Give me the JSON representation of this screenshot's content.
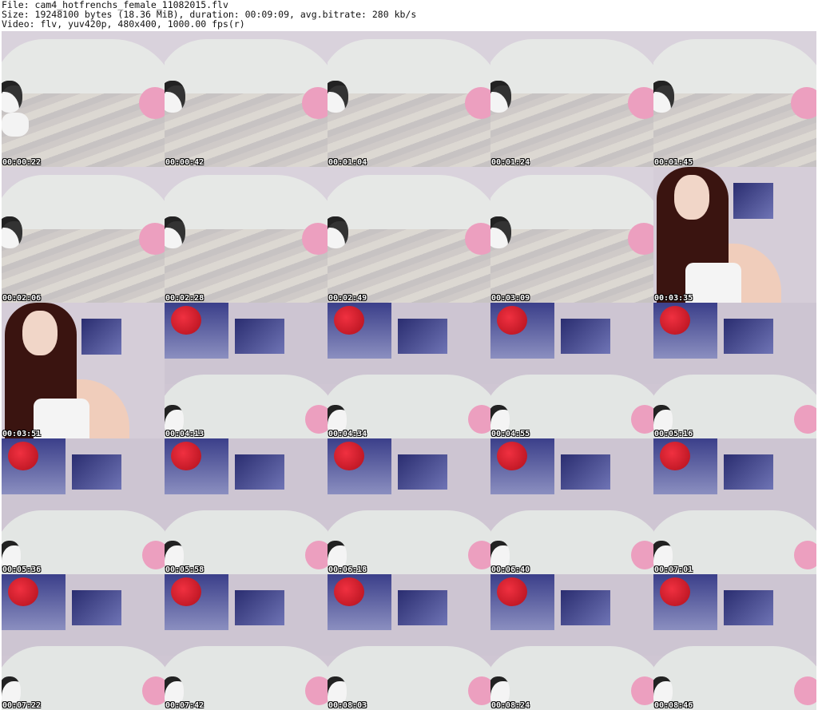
{
  "header": {
    "line1": "File: cam4_hotfrenchs_female_11082015.flv",
    "line2": "Size: 19248100 bytes (18.36 MiB), duration: 00:09:09, avg.bitrate: 280 kb/s",
    "line3": "Video: flv, yuv420p, 480x400, 1000.00 fps(r)"
  },
  "thumbnails": [
    {
      "time": "00:00:22",
      "scene": "a"
    },
    {
      "time": "00:00:42",
      "scene": "a"
    },
    {
      "time": "00:01:04",
      "scene": "a"
    },
    {
      "time": "00:01:24",
      "scene": "a"
    },
    {
      "time": "00:01:45",
      "scene": "a"
    },
    {
      "time": "00:02:06",
      "scene": "a"
    },
    {
      "time": "00:02:28",
      "scene": "a"
    },
    {
      "time": "00:02:49",
      "scene": "a"
    },
    {
      "time": "00:03:09",
      "scene": "a"
    },
    {
      "time": "00:03:35",
      "scene": "c"
    },
    {
      "time": "00:03:51",
      "scene": "c"
    },
    {
      "time": "00:04:13",
      "scene": "b"
    },
    {
      "time": "00:04:34",
      "scene": "b"
    },
    {
      "time": "00:04:55",
      "scene": "b"
    },
    {
      "time": "00:05:16",
      "scene": "b"
    },
    {
      "time": "00:05:36",
      "scene": "b"
    },
    {
      "time": "00:05:58",
      "scene": "b"
    },
    {
      "time": "00:06:18",
      "scene": "b"
    },
    {
      "time": "00:06:40",
      "scene": "b"
    },
    {
      "time": "00:07:01",
      "scene": "b"
    },
    {
      "time": "00:07:22",
      "scene": "b"
    },
    {
      "time": "00:07:42",
      "scene": "b"
    },
    {
      "time": "00:08:03",
      "scene": "b"
    },
    {
      "time": "00:08:24",
      "scene": "b"
    },
    {
      "time": "00:08:46",
      "scene": "b"
    }
  ]
}
